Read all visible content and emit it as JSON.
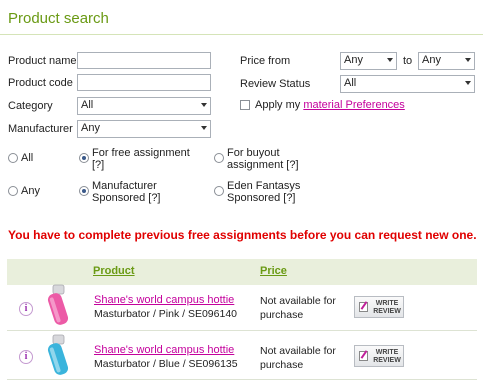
{
  "header": {
    "title": "Product search"
  },
  "form": {
    "product_name_label": "Product name",
    "product_code_label": "Product code",
    "category_label": "Category",
    "category_value": "All",
    "manufacturer_label": "Manufacturer",
    "manufacturer_value": "Any",
    "price_from_label": "Price from",
    "price_from_value": "Any",
    "price_to_label": "to",
    "price_to_value": "Any",
    "review_status_label": "Review Status",
    "review_status_value": "All",
    "apply_prefix": "Apply my",
    "apply_link": "material Preferences",
    "apply_checked": false
  },
  "assignment_radios": [
    {
      "label": "All",
      "checked": false
    },
    {
      "label": "For free assignment [?]",
      "checked": true
    },
    {
      "label": "For buyout assignment [?]",
      "checked": false
    }
  ],
  "sponsor_radios": [
    {
      "label": "Any",
      "checked": false
    },
    {
      "label": "Manufacturer Sponsored [?]",
      "checked": true
    },
    {
      "label": "Eden Fantasys Sponsored [?]",
      "checked": false
    }
  ],
  "warning": "You have to complete previous free assignments before you can request new one.",
  "table": {
    "col_product": "Product",
    "col_price": "Price",
    "rows": [
      {
        "name": "Shane's world campus hottie",
        "details": "Masturbator / Pink / SE096140",
        "price": "Not available for purchase",
        "button": "WRITE REVIEW",
        "color": "#ec5aa6"
      },
      {
        "name": "Shane's world campus hottie",
        "details": "Masturbator / Blue / SE096135",
        "price": "Not available for purchase",
        "button": "WRITE REVIEW",
        "color": "#3ab4dc"
      }
    ]
  },
  "icons": {
    "info": "info-icon",
    "write_review": "pen-icon"
  },
  "colors": {
    "brand_green": "#6a9a14",
    "link_magenta": "#c4009c",
    "warning_red": "#e00000",
    "header_bg": "#e9efdc"
  }
}
